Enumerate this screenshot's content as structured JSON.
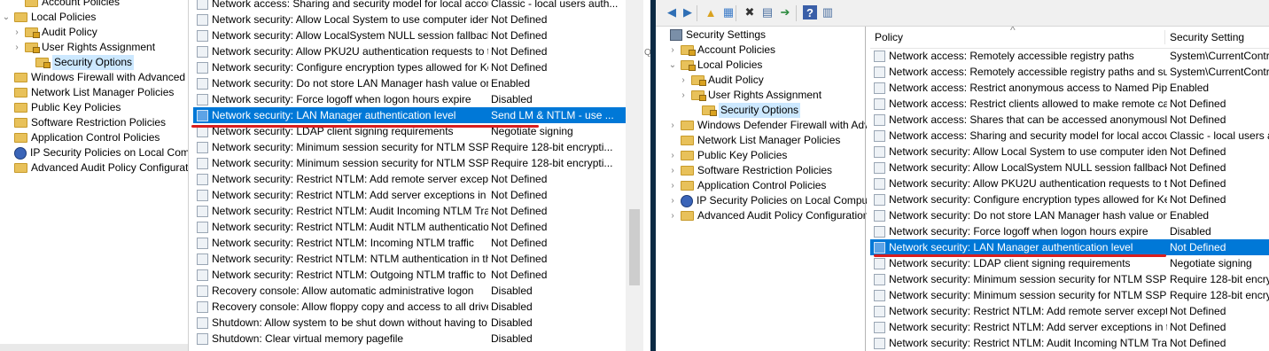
{
  "left": {
    "tree": [
      {
        "label": "Account Policies",
        "indent": 1,
        "icon": "folder",
        "expander": ""
      },
      {
        "label": "Local Policies",
        "indent": 0,
        "icon": "folder",
        "expander": "⌄"
      },
      {
        "label": "Audit Policy",
        "indent": 1,
        "icon": "folder-lock",
        "expander": "›"
      },
      {
        "label": "User Rights Assignment",
        "indent": 1,
        "icon": "folder-lock",
        "expander": "›"
      },
      {
        "label": "Security Options",
        "indent": 2,
        "icon": "folder-lock",
        "expander": "",
        "selected": true
      },
      {
        "label": "Windows Firewall with Advanced Secu",
        "indent": 0,
        "icon": "folder",
        "expander": ""
      },
      {
        "label": "Network List Manager Policies",
        "indent": 0,
        "icon": "folder",
        "expander": ""
      },
      {
        "label": "Public Key Policies",
        "indent": 0,
        "icon": "folder",
        "expander": ""
      },
      {
        "label": "Software Restriction Policies",
        "indent": 0,
        "icon": "folder",
        "expander": ""
      },
      {
        "label": "Application Control Policies",
        "indent": 0,
        "icon": "folder",
        "expander": ""
      },
      {
        "label": "IP Security Policies on Local Compute",
        "indent": 0,
        "icon": "ip",
        "expander": ""
      },
      {
        "label": "Advanced Audit Policy Configuration",
        "indent": 0,
        "icon": "folder",
        "expander": ""
      }
    ],
    "rows": [
      {
        "policy": "Network access: Sharing and security model for local accou...",
        "setting": "Classic - local users auth..."
      },
      {
        "policy": "Network security: Allow Local System to use computer ident...",
        "setting": "Not Defined"
      },
      {
        "policy": "Network security: Allow LocalSystem NULL session fallback",
        "setting": "Not Defined"
      },
      {
        "policy": "Network security: Allow PKU2U authentication requests to t...",
        "setting": "Not Defined"
      },
      {
        "policy": "Network security: Configure encryption types allowed for Ke...",
        "setting": "Not Defined"
      },
      {
        "policy": "Network security: Do not store LAN Manager hash value on ...",
        "setting": "Enabled"
      },
      {
        "policy": "Network security: Force logoff when logon hours expire",
        "setting": "Disabled"
      },
      {
        "policy": "Network security: LAN Manager authentication level",
        "setting": "Send LM & NTLM - use ...",
        "selected": true
      },
      {
        "policy": "Network security: LDAP client signing requirements",
        "setting": "Negotiate signing"
      },
      {
        "policy": "Network security: Minimum session security for NTLM SSP ...",
        "setting": "Require 128-bit encrypti..."
      },
      {
        "policy": "Network security: Minimum session security for NTLM SSP ...",
        "setting": "Require 128-bit encrypti..."
      },
      {
        "policy": "Network security: Restrict NTLM: Add remote server excepti...",
        "setting": "Not Defined"
      },
      {
        "policy": "Network security: Restrict NTLM: Add server exceptions in t...",
        "setting": "Not Defined"
      },
      {
        "policy": "Network security: Restrict NTLM: Audit Incoming NTLM Tra...",
        "setting": "Not Defined"
      },
      {
        "policy": "Network security: Restrict NTLM: Audit NTLM authenticatio...",
        "setting": "Not Defined"
      },
      {
        "policy": "Network security: Restrict NTLM: Incoming NTLM traffic",
        "setting": "Not Defined"
      },
      {
        "policy": "Network security: Restrict NTLM: NTLM authentication in th...",
        "setting": "Not Defined"
      },
      {
        "policy": "Network security: Restrict NTLM: Outgoing NTLM traffic to ...",
        "setting": "Not Defined"
      },
      {
        "policy": "Recovery console: Allow automatic administrative logon",
        "setting": "Disabled"
      },
      {
        "policy": "Recovery console: Allow floppy copy and access to all drives...",
        "setting": "Disabled"
      },
      {
        "policy": "Shutdown: Allow system to be shut down without having to...",
        "setting": "Disabled"
      },
      {
        "policy": "Shutdown: Clear virtual memory pagefile",
        "setting": "Disabled"
      }
    ],
    "edge_label": "Q"
  },
  "right": {
    "toolbar_icons": [
      "back-arrow-icon",
      "forward-arrow-icon",
      "up-folder-icon",
      "show-tree-icon",
      "delete-icon",
      "properties-icon",
      "export-icon",
      "help-icon",
      "view-icon"
    ],
    "tree": [
      {
        "label": "Security Settings",
        "indent": 0,
        "icon": "sec",
        "expander": ""
      },
      {
        "label": "Account Policies",
        "indent": 1,
        "icon": "folder-lock",
        "expander": "›"
      },
      {
        "label": "Local Policies",
        "indent": 1,
        "icon": "folder-lock",
        "expander": "⌄"
      },
      {
        "label": "Audit Policy",
        "indent": 2,
        "icon": "folder-lock",
        "expander": "›"
      },
      {
        "label": "User Rights Assignment",
        "indent": 2,
        "icon": "folder-lock",
        "expander": "›"
      },
      {
        "label": "Security Options",
        "indent": 3,
        "icon": "folder-lock",
        "expander": "",
        "selected": true
      },
      {
        "label": "Windows Defender Firewall with Adva",
        "indent": 1,
        "icon": "folder",
        "expander": "›"
      },
      {
        "label": "Network List Manager Policies",
        "indent": 1,
        "icon": "folder",
        "expander": ""
      },
      {
        "label": "Public Key Policies",
        "indent": 1,
        "icon": "folder",
        "expander": "›"
      },
      {
        "label": "Software Restriction Policies",
        "indent": 1,
        "icon": "folder",
        "expander": "›"
      },
      {
        "label": "Application Control Policies",
        "indent": 1,
        "icon": "folder",
        "expander": "›"
      },
      {
        "label": "IP Security Policies on Local Compute",
        "indent": 1,
        "icon": "ip",
        "expander": "›"
      },
      {
        "label": "Advanced Audit Policy Configuration",
        "indent": 1,
        "icon": "folder",
        "expander": "›"
      }
    ],
    "header": {
      "policy": "Policy",
      "setting": "Security Setting",
      "sort_glyph": "^"
    },
    "rows": [
      {
        "policy": "Network access: Remotely accessible registry paths",
        "setting": "System\\CurrentContro"
      },
      {
        "policy": "Network access: Remotely accessible registry paths and sub...",
        "setting": "System\\CurrentContro"
      },
      {
        "policy": "Network access: Restrict anonymous access to Named Pipes...",
        "setting": "Enabled"
      },
      {
        "policy": "Network access: Restrict clients allowed to make remote call...",
        "setting": "Not Defined"
      },
      {
        "policy": "Network access: Shares that can be accessed anonymously",
        "setting": "Not Defined"
      },
      {
        "policy": "Network access: Sharing and security model for local accou...",
        "setting": "Classic - local users au"
      },
      {
        "policy": "Network security: Allow Local System to use computer ident...",
        "setting": "Not Defined"
      },
      {
        "policy": "Network security: Allow LocalSystem NULL session fallback",
        "setting": "Not Defined"
      },
      {
        "policy": "Network security: Allow PKU2U authentication requests to t...",
        "setting": "Not Defined"
      },
      {
        "policy": "Network security: Configure encryption types allowed for Ke...",
        "setting": "Not Defined"
      },
      {
        "policy": "Network security: Do not store LAN Manager hash value on ...",
        "setting": "Enabled"
      },
      {
        "policy": "Network security: Force logoff when logon hours expire",
        "setting": "Disabled"
      },
      {
        "policy": "Network security: LAN Manager authentication level",
        "setting": "Not Defined",
        "selected": true
      },
      {
        "policy": "Network security: LDAP client signing requirements",
        "setting": "Negotiate signing"
      },
      {
        "policy": "Network security: Minimum session security for NTLM SSP ...",
        "setting": "Require 128-bit encryp"
      },
      {
        "policy": "Network security: Minimum session security for NTLM SSP ...",
        "setting": "Require 128-bit encryp"
      },
      {
        "policy": "Network security: Restrict NTLM: Add remote server excepti...",
        "setting": "Not Defined"
      },
      {
        "policy": "Network security: Restrict NTLM: Add server exceptions in t...",
        "setting": "Not Defined"
      },
      {
        "policy": "Network security: Restrict NTLM: Audit Incoming NTLM Tra...",
        "setting": "Not Defined"
      }
    ]
  },
  "colors": {
    "selection": "#0078d7",
    "annotation": "#d91e1e",
    "tree_selected": "#cce8ff"
  }
}
